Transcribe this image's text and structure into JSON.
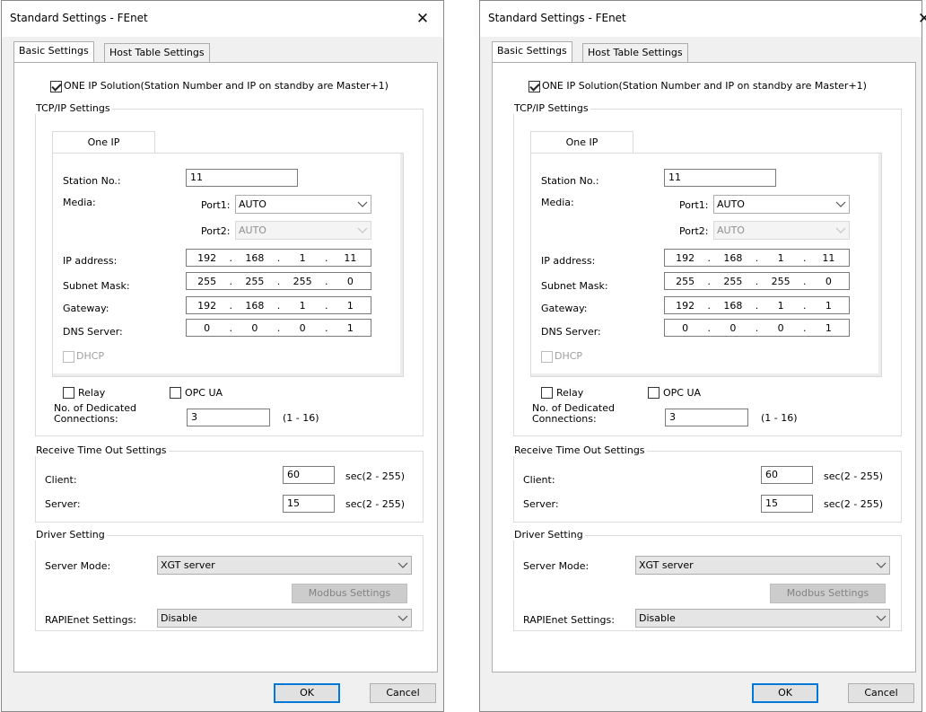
{
  "dialog": {
    "title": "Standard Settings - FEnet",
    "close_symbol": "✕"
  },
  "tabs": [
    {
      "label": "Basic Settings",
      "active": true
    },
    {
      "label": "Host Table Settings",
      "active": false
    }
  ],
  "one_ip_solution": {
    "checked": true,
    "label": "ONE IP Solution(Station Number and IP on standby are Master+1)"
  },
  "tcpip": {
    "group_label": "TCP/IP Settings",
    "inner_tab_label": "One IP",
    "station_label": "Station No.:",
    "station_value": "11",
    "media_label": "Media:",
    "port1_label": "Port1:",
    "port1_value": "AUTO",
    "port2_label": "Port2:",
    "port2_value": "AUTO",
    "ip_label": "IP address:",
    "ip": [
      "192",
      "168",
      "1",
      "11"
    ],
    "subnet_label": "Subnet Mask:",
    "subnet": [
      "255",
      "255",
      "255",
      "0"
    ],
    "gateway_label": "Gateway:",
    "gateway": [
      "192",
      "168",
      "1",
      "1"
    ],
    "dns_label": "DNS Server:",
    "dns": [
      "0",
      "0",
      "0",
      "1"
    ],
    "ip_separator": ".",
    "dhcp_label": "DHCP",
    "dhcp_checked": false,
    "relay_label": "Relay",
    "relay_checked": false,
    "opcua_label": "OPC UA",
    "opcua_checked": false,
    "dedicated_label_line1": "No. of Dedicated",
    "dedicated_label_line2": "Connections:",
    "dedicated_value": "3",
    "dedicated_range": "(1 - 16)"
  },
  "receive_timeout": {
    "group_label": "Receive Time Out Settings",
    "client_label": "Client:",
    "client_value": "60",
    "client_unit": "sec(2 - 255)",
    "server_label": "Server:",
    "server_value": "15",
    "server_unit": "sec(2 - 255)"
  },
  "driver": {
    "group_label": "Driver Setting",
    "server_mode_label": "Server Mode:",
    "server_mode_value": "XGT server",
    "modbus_button": "Modbus Settings",
    "rapienet_label": "RAPIEnet Settings:",
    "rapienet_value": "Disable"
  },
  "buttons": {
    "ok": "OK",
    "cancel": "Cancel"
  }
}
